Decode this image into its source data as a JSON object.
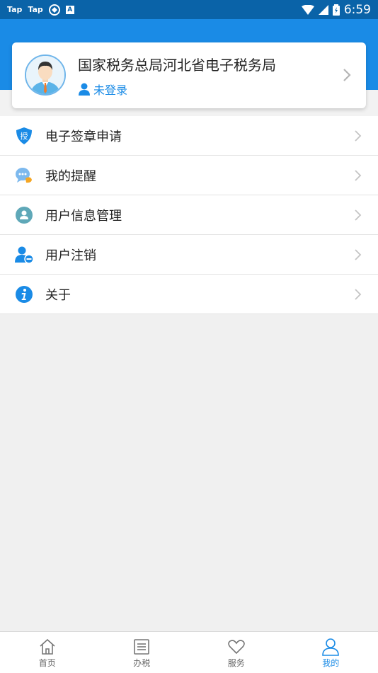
{
  "status_bar": {
    "left_labels": [
      "Tap",
      "Tap"
    ],
    "box_label": "A",
    "time": "6:59"
  },
  "profile": {
    "org_name": "国家税务总局河北省电子税务局",
    "login_status": "未登录"
  },
  "menu": {
    "items": [
      {
        "label": "电子签章申请",
        "icon": "shield-icon"
      },
      {
        "label": "我的提醒",
        "icon": "chat-bubble-icon"
      },
      {
        "label": "用户信息管理",
        "icon": "user-circle-icon"
      },
      {
        "label": "用户注销",
        "icon": "user-remove-icon"
      },
      {
        "label": "关于",
        "icon": "info-icon"
      }
    ]
  },
  "bottom_nav": {
    "items": [
      {
        "label": "首页",
        "icon": "home-icon"
      },
      {
        "label": "办税",
        "icon": "list-icon"
      },
      {
        "label": "服务",
        "icon": "heart-icon"
      },
      {
        "label": "我的",
        "icon": "person-icon"
      }
    ],
    "active_index": 3
  },
  "colors": {
    "primary": "#1a8be6",
    "status_bar": "#0a63a8",
    "background": "#f0f0f0"
  }
}
